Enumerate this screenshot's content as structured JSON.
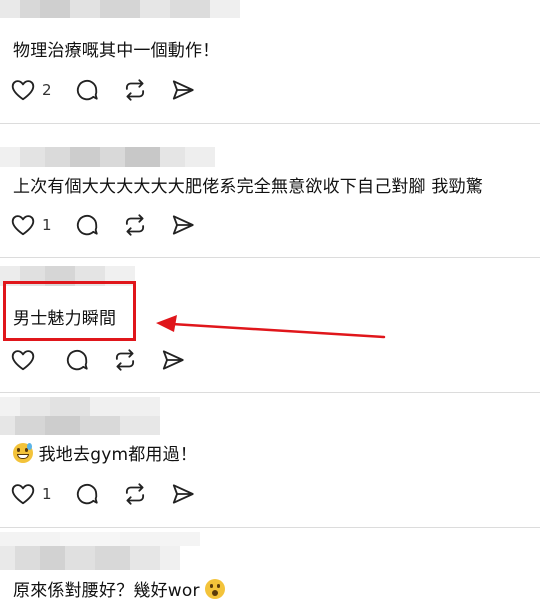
{
  "posts": [
    {
      "text": "物理治療嘅其中一個動作！",
      "likes": "2"
    },
    {
      "text": "上次有個大大大大大大肥佬系完全無意欲收下自己對腳 我勁驚",
      "likes": "1"
    },
    {
      "text": "男士魅力瞬間",
      "likes": ""
    },
    {
      "text": "我地去gym都用過！",
      "likes": "1",
      "emoji": "grinning-sweat-emoji"
    },
    {
      "text": "原來係對腰好？幾好wor",
      "likes": "",
      "emoji": "hushed-face-emoji"
    }
  ],
  "colors": {
    "annotation": "#e0161b",
    "divider": "#dcdcdc",
    "icon": "#222222"
  },
  "icons": [
    "heart-icon",
    "comment-icon",
    "repost-icon",
    "share-icon"
  ]
}
